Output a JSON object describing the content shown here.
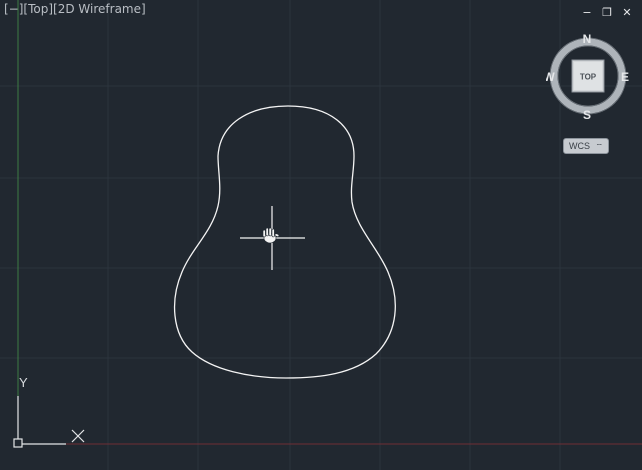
{
  "viewport": {
    "control_label": "[−]",
    "view_label": "[Top]",
    "style_label": "[2D Wireframe]"
  },
  "window_controls": {
    "minimize": "−",
    "restore": "❐",
    "close": "✕"
  },
  "viewcube": {
    "north": "N",
    "south": "S",
    "east": "E",
    "west": "W",
    "face": "TOP"
  },
  "wcs": {
    "label": "WCS",
    "arrow": "⌔"
  },
  "ucs": {
    "x_label": "X",
    "y_label": "Y"
  },
  "colors": {
    "background": "#212830",
    "grid": "#2d353e",
    "y_axis_line": "#3f7e46",
    "x_axis_line": "#7a3138",
    "geometry": "#f4f4f4",
    "text": "#b9bec4"
  }
}
